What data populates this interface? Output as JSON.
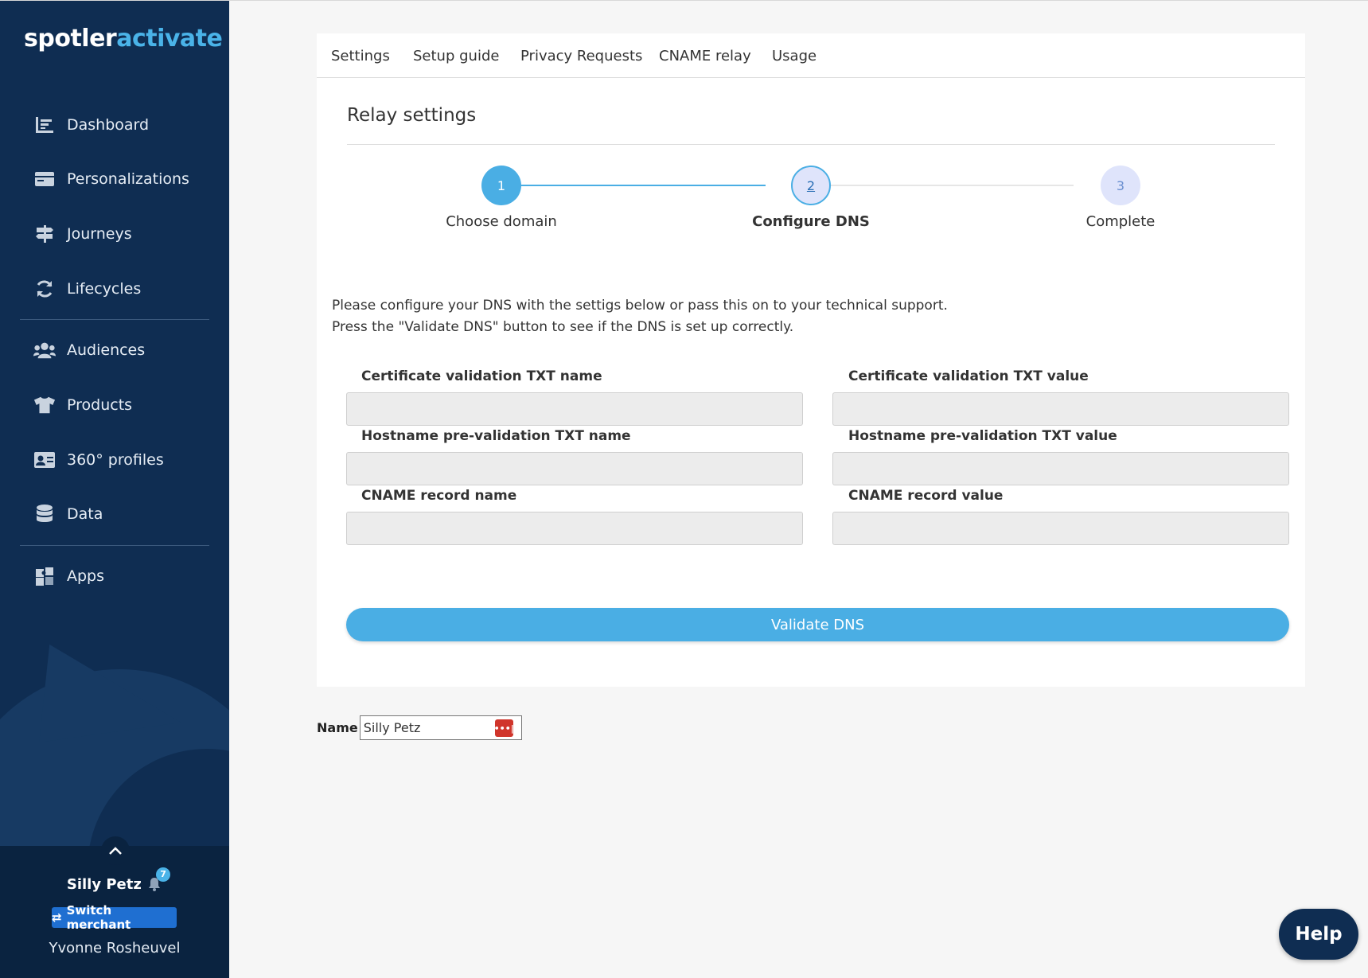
{
  "brand": {
    "part1": "spotler",
    "part2": "activate"
  },
  "sidebar": {
    "items": [
      {
        "label": "Dashboard",
        "icon": "dashboard-icon"
      },
      {
        "label": "Personalizations",
        "icon": "personalizations-icon"
      },
      {
        "label": "Journeys",
        "icon": "signpost-icon"
      },
      {
        "label": "Lifecycles",
        "icon": "refresh-icon"
      },
      {
        "label": "Audiences",
        "icon": "users-icon"
      },
      {
        "label": "Products",
        "icon": "tshirt-icon"
      },
      {
        "label": "360° profiles",
        "icon": "id-card-icon"
      },
      {
        "label": "Data",
        "icon": "database-icon"
      },
      {
        "label": "Apps",
        "icon": "puzzle-icon"
      }
    ],
    "merchant": {
      "name": "Silly Petz",
      "notifications": "7",
      "switch_label": "Switch merchant",
      "user": "Yvonne Rosheuvel"
    }
  },
  "tabs": [
    "Settings",
    "Setup guide",
    "Privacy Requests",
    "CNAME relay",
    "Usage"
  ],
  "section_title": "Relay settings",
  "steps": [
    {
      "number": "1",
      "label": "Choose domain",
      "state": "done"
    },
    {
      "number": "2",
      "label": "Configure DNS",
      "state": "active"
    },
    {
      "number": "3",
      "label": "Complete",
      "state": "pending"
    }
  ],
  "info": {
    "line1": "Please configure your DNS with the settigs below or pass this on to your technical support.",
    "line2": "Press the \"Validate DNS\" button to see if the DNS is set up correctly."
  },
  "fields": {
    "cert_name": {
      "label": "Certificate validation TXT name",
      "value": ""
    },
    "cert_value": {
      "label": "Certificate validation TXT value",
      "value": ""
    },
    "host_name": {
      "label": "Hostname pre-validation TXT name",
      "value": ""
    },
    "host_value": {
      "label": "Hostname pre-validation TXT value",
      "value": ""
    },
    "cname_name": {
      "label": "CNAME record name",
      "value": ""
    },
    "cname_value": {
      "label": "CNAME record value",
      "value": ""
    }
  },
  "validate_button": "Validate DNS",
  "name_field": {
    "label": "Name",
    "value": "Silly Petz"
  },
  "help_button": "Help",
  "colors": {
    "sidebar": "#0f2d52",
    "accent": "#4aaee4",
    "pending": "#dfe4fb"
  }
}
